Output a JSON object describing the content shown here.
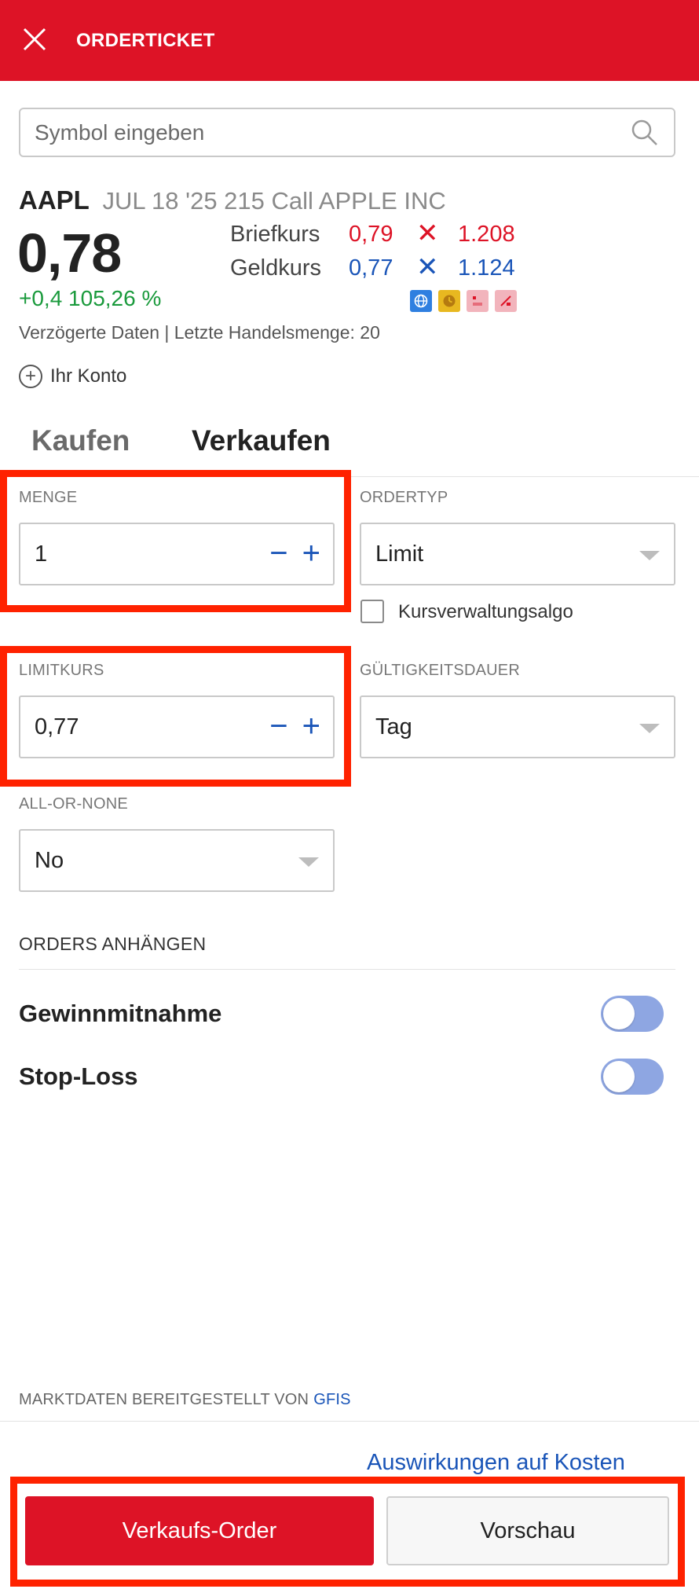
{
  "header": {
    "title": "ORDERTICKET",
    "close_icon": "close-icon"
  },
  "search": {
    "placeholder": "Symbol eingeben",
    "value": ""
  },
  "instrument": {
    "ticker": "AAPL",
    "description": "JUL 18 '25 215 Call APPLE INC",
    "last_price": "0,78",
    "change": "+0,4 105,26 %",
    "ask_label": "Briefkurs",
    "ask_price": "0,79",
    "ask_size": "1.208",
    "bid_label": "Geldkurs",
    "bid_price": "0,77",
    "bid_size": "1.124",
    "separator": "✕",
    "delayed_text": "Verzögerte Daten | Letzte Handelsmenge: 20"
  },
  "account": {
    "label": "Ihr Konto"
  },
  "tabs": [
    {
      "label": "Kaufen",
      "active": false
    },
    {
      "label": "Verkaufen",
      "active": true
    }
  ],
  "form": {
    "quantity": {
      "label": "MENGE",
      "value": "1"
    },
    "order_type": {
      "label": "ORDERTYP",
      "value": "Limit"
    },
    "algo": {
      "label": "Kursverwaltungsalgo",
      "checked": false
    },
    "limit_price": {
      "label": "LIMITKURS",
      "value": "0,77"
    },
    "time_in_force": {
      "label": "GÜLTIGKEITSDAUER",
      "value": "Tag"
    },
    "all_or_none": {
      "label": "ALL-OR-NONE",
      "value": "No"
    },
    "stepper": {
      "minus": "−",
      "plus": "+"
    }
  },
  "attach_orders": {
    "title": "ORDERS ANHÄNGEN",
    "take_profit": {
      "label": "Gewinnmitnahme",
      "enabled": false
    },
    "stop_loss": {
      "label": "Stop-Loss",
      "enabled": false
    }
  },
  "footer": {
    "market_data_text": "MARKTDATEN BEREITGESTELLT VON",
    "market_data_provider": "GFIS",
    "cost_link": "Auswirkungen auf Kosten",
    "submit_label": "Verkaufs-Order",
    "preview_label": "Vorschau"
  },
  "colors": {
    "brand_red": "#DD1326",
    "link_blue": "#1a55b8",
    "positive_green": "#1a9a3c",
    "highlight_red": "#FF2200",
    "toggle_off": "#8ea6e2"
  }
}
